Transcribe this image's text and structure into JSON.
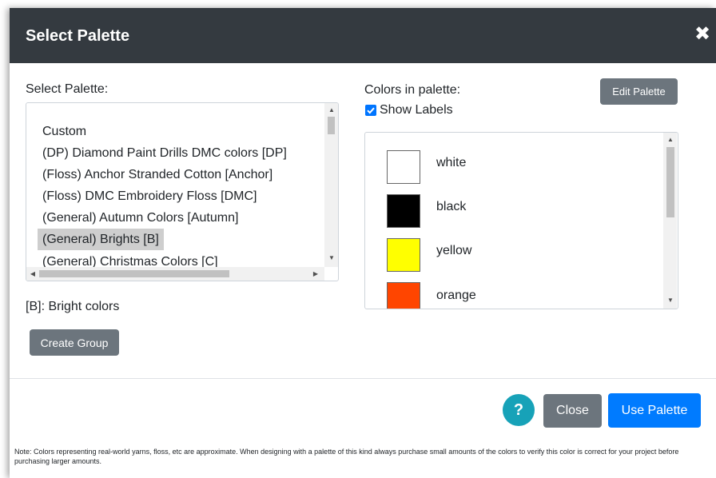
{
  "dialog": {
    "title": "Select Palette",
    "close_glyph": "✖"
  },
  "left": {
    "select_label": "Select Palette:",
    "palettes": [
      "Custom",
      "(DP) Diamond Paint Drills DMC colors [DP]",
      "(Floss) Anchor Stranded Cotton [Anchor]",
      "(Floss) DMC Embroidery Floss [DMC]",
      "(General) Autumn Colors [Autumn]",
      "(General) Brights [B]",
      "(General) Christmas Colors [C]"
    ],
    "selected_palette": "(General) Brights [B]",
    "description": "[B]: Bright colors",
    "create_group_label": "Create Group"
  },
  "right": {
    "colors_label": "Colors in palette:",
    "edit_palette_label": "Edit Palette",
    "show_labels_label": "Show Labels",
    "show_labels_checked": true,
    "colors": [
      {
        "name": "white",
        "hex": "#ffffff"
      },
      {
        "name": "black",
        "hex": "#000000"
      },
      {
        "name": "yellow",
        "hex": "#ffff00"
      },
      {
        "name": "orange",
        "hex": "#ff4500"
      }
    ]
  },
  "footer": {
    "help_glyph": "?",
    "close_label": "Close",
    "use_palette_label": "Use Palette",
    "note": "Note: Colors representing real-world yarns, floss, etc are approximate. When designing with a palette of this kind always purchase small amounts of the colors to verify this color is correct for your project before purchasing larger amounts."
  },
  "icons": [
    "close-icon",
    "checkbox-check-icon",
    "scroll-up-arrow-icon",
    "scroll-down-arrow-icon",
    "scroll-left-arrow-icon",
    "scroll-right-arrow-icon",
    "help-icon"
  ]
}
